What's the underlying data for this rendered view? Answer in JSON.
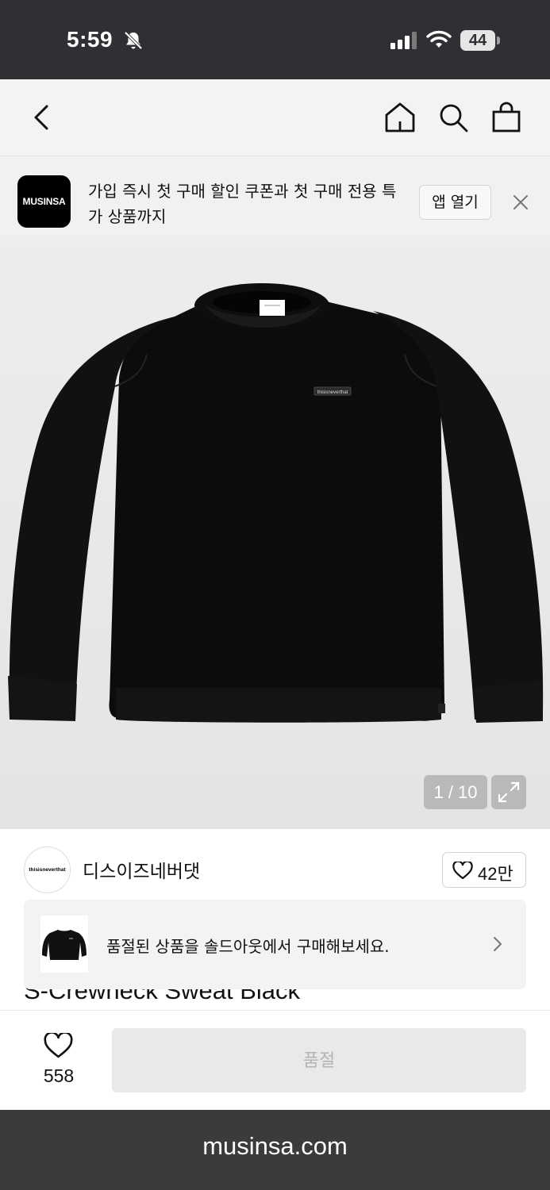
{
  "status_bar": {
    "time": "5:59",
    "battery": "44"
  },
  "nav": {
    "back_icon": "chevron-left-icon",
    "home_icon": "home-icon",
    "search_icon": "search-icon",
    "cart_icon": "shopping-bag-icon"
  },
  "app_banner": {
    "logo_text": "MUSINSA",
    "message": "가입 즉시 첫 구매 할인 쿠폰과 첫 구매 전용 특가 상품까지",
    "open_button": "앱 열기",
    "close_icon": "close-icon"
  },
  "gallery": {
    "current": "1",
    "total": "10",
    "counter": "1 / 10",
    "expand_icon": "expand-icon",
    "chest_label": "thisisneverthat"
  },
  "brand": {
    "logo_text": "thisisneverthat",
    "name": "디스이즈네버댓",
    "likes": "42만"
  },
  "product": {
    "name": "S-Crewneck Sweat Black"
  },
  "soldout_notice": {
    "text": "품절된 상품을 솔드아웃에서 구매해보세요."
  },
  "bottom_bar": {
    "wish_count": "558",
    "status_button": "품절"
  },
  "browser": {
    "url": "musinsa.com"
  },
  "colors": {
    "status_bar_bg": "#2f3033",
    "nav_bg": "#f3f3f3",
    "soldout_button_bg": "#e9e9e9",
    "soldout_button_text": "#b4b4b4"
  }
}
